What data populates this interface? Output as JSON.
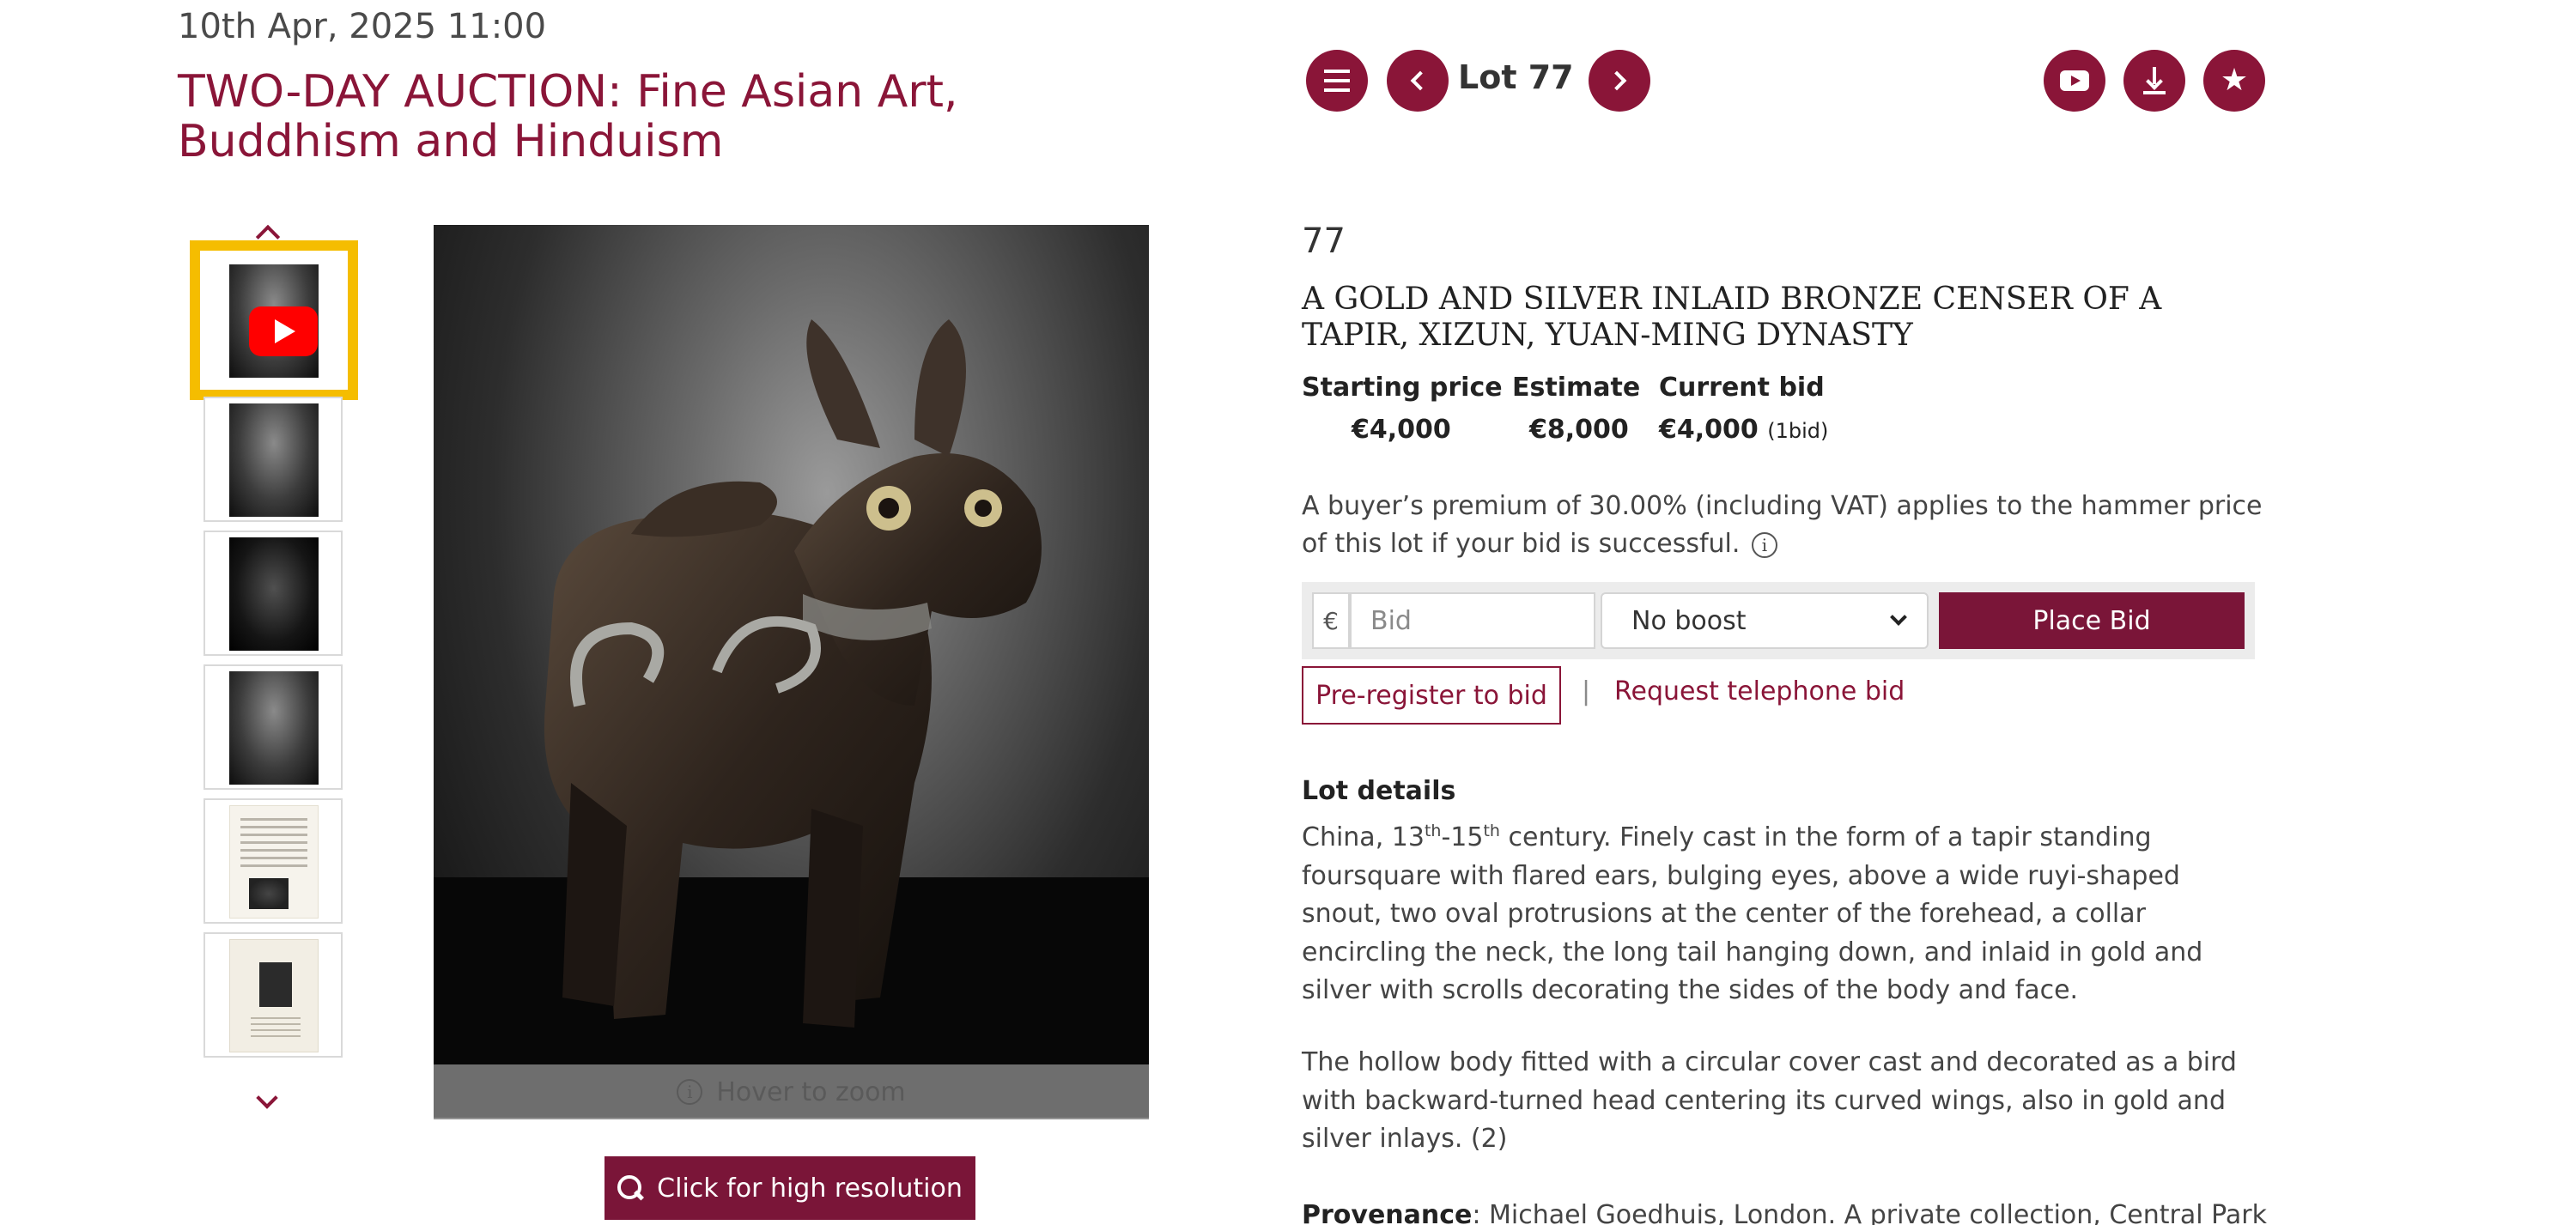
{
  "auction": {
    "date": "10th Apr, 2025 11:00",
    "title": "TWO-DAY AUCTION: Fine Asian Art, Buddhism and Hinduism"
  },
  "nav": {
    "lot_label": "Lot 77",
    "icons": [
      "list-icon",
      "chevron-left-icon",
      "chevron-right-icon",
      "youtube-icon",
      "download-icon",
      "star-icon"
    ]
  },
  "gallery": {
    "zoom_hint": "Hover to zoom",
    "hires_label": "Click for high resolution",
    "thumbnails": [
      "video",
      "photo",
      "photo",
      "photo",
      "document",
      "book"
    ]
  },
  "lot": {
    "number": "77",
    "title": "A GOLD AND SILVER INLAID BRONZE CENSER OF A TAPIR, XIZUN, YUAN-MING DYNASTY",
    "starting_price_label": "Starting price",
    "starting_price": "€4,000",
    "estimate_label": "Estimate",
    "estimate": "€8,000",
    "current_bid_label": "Current bid",
    "current_bid": "€4,000",
    "bid_count": "(1bid)",
    "premium_text": "A buyer’s premium of 30.00% (including VAT) applies to the hammer price of this lot if your bid is successful."
  },
  "bid_form": {
    "currency": "€",
    "bid_placeholder": "Bid",
    "boost_selected": "No boost",
    "place_bid_label": "Place Bid",
    "preregister_label": "Pre-register to bid",
    "separator": "|",
    "telephone_label": "Request telephone bid"
  },
  "details": {
    "heading": "Lot details",
    "p1_prefix": "China, 13",
    "p1_sup1": "th",
    "p1_dash": "-15",
    "p1_sup2": "th",
    "p1_rest": " century. Finely cast in the form of a tapir standing foursquare with flared ears, bulging eyes, above a wide ruyi-shaped snout, two oval protrusions at the center of the forehead, a collar encircling the neck, the long tail hanging down, and inlaid in gold and silver with scrolls decorating the sides of the body and face.",
    "p2": "The hollow body fitted with a circular cover cast and decorated as a bird with backward-turned head centering its curved wings, also in gold and silver inlays. (2)",
    "provenance_label": "Provenance",
    "provenance_text": ": Michael Goedhuis, London. A private collection, Central Park"
  },
  "colors": {
    "brand": "#8a1538",
    "button": "#7a1538",
    "highlight": "#f5bd00",
    "youtube": "#ff0000"
  }
}
